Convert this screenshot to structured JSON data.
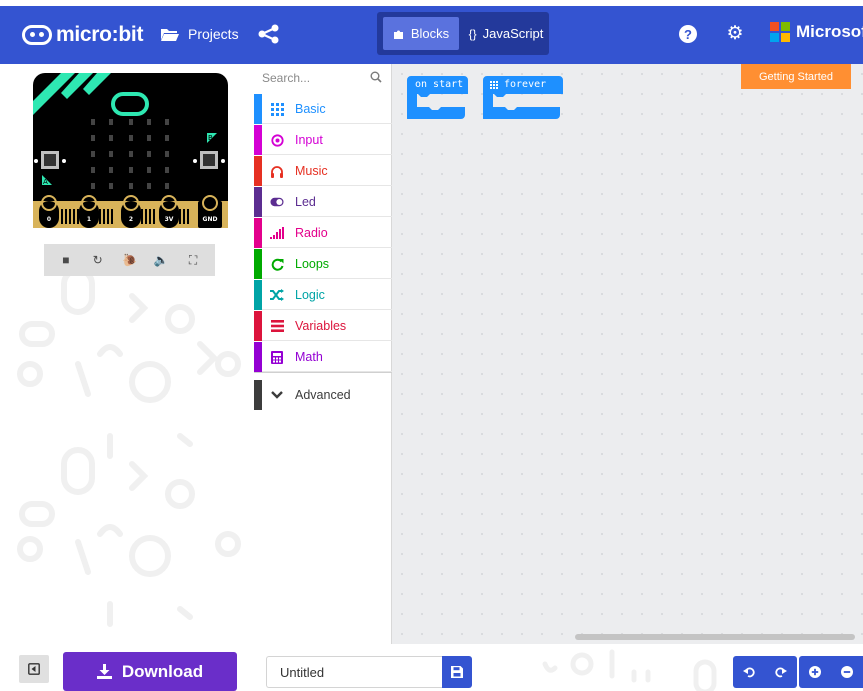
{
  "colors": {
    "header": "#3454d1",
    "header_toggle": "#23399b",
    "blocks_active": "#5a72de",
    "download": "#6a2ec9",
    "getting_started": "#ff8f32",
    "basic": "#1e90ff",
    "input": "#d400d4",
    "music": "#e63022",
    "led": "#5c2d91",
    "radio": "#e3008c",
    "loops": "#00aa00",
    "logic": "#00a4a6",
    "variables": "#dc143c",
    "math": "#9400d3",
    "advanced": "#3c3c3c"
  },
  "header": {
    "logo_text": "micro:bit",
    "logo_icon": "microbit-face-icon",
    "projects_label": "Projects",
    "projects_icon": "folder-open-icon",
    "share_icon": "share-icon",
    "blocks_label": "Blocks",
    "blocks_icon": "puzzle-piece-icon",
    "javascript_label": "JavaScript",
    "javascript_icon": "{}",
    "help_icon": "question-circle-icon",
    "settings_icon": "gear-icon",
    "brand_text": "Microsoft"
  },
  "simulator": {
    "pins": [
      "0",
      "1",
      "2",
      "3V",
      "GND"
    ],
    "button_a": "A",
    "button_b": "B",
    "toolbar": [
      {
        "name": "stop-button",
        "icon": "stop-icon",
        "glyph": "■"
      },
      {
        "name": "restart-button",
        "icon": "refresh-icon",
        "glyph": "↻"
      },
      {
        "name": "slow-mo-button",
        "icon": "snail-icon",
        "glyph": "🐌"
      },
      {
        "name": "mute-button",
        "icon": "volume-icon",
        "glyph": "🔈"
      },
      {
        "name": "fullscreen-button",
        "icon": "expand-icon",
        "glyph": "⛶"
      }
    ]
  },
  "toolbox": {
    "search_placeholder": "Search...",
    "categories": [
      {
        "label": "Basic",
        "icon": "grid-icon",
        "glyph": "▦",
        "color": "#1e90ff"
      },
      {
        "label": "Input",
        "icon": "target-icon",
        "glyph": "◉",
        "color": "#d400d4"
      },
      {
        "label": "Music",
        "icon": "headphones-icon",
        "glyph": "♫",
        "color": "#e63022"
      },
      {
        "label": "Led",
        "icon": "toggle-icon",
        "glyph": "◐",
        "color": "#5c2d91"
      },
      {
        "label": "Radio",
        "icon": "signal-bars-icon",
        "glyph": "▂▄▆",
        "color": "#e3008c"
      },
      {
        "label": "Loops",
        "icon": "loop-icon",
        "glyph": "↻",
        "color": "#00aa00"
      },
      {
        "label": "Logic",
        "icon": "shuffle-icon",
        "glyph": "⤨",
        "color": "#00a4a6"
      },
      {
        "label": "Variables",
        "icon": "list-icon",
        "glyph": "≡",
        "color": "#dc143c"
      },
      {
        "label": "Math",
        "icon": "calculator-icon",
        "glyph": "▦",
        "color": "#9400d3"
      }
    ],
    "advanced": {
      "label": "Advanced",
      "icon": "chevron-down-icon",
      "glyph": "⌄",
      "color": "#3c3c3c"
    }
  },
  "workspace": {
    "getting_started_label": "Getting Started",
    "blocks": [
      {
        "label": "on start",
        "color": "#1e90ff"
      },
      {
        "label": "forever",
        "color": "#1e90ff",
        "icon": "grid-icon"
      }
    ]
  },
  "footer": {
    "download_label": "Download",
    "download_icon": "download-icon",
    "collapse_icon": "collapse-panel-icon",
    "project_name": "Untitled",
    "save_icon": "floppy-disk-icon",
    "undo_icon": "undo-icon",
    "redo_icon": "redo-icon",
    "zoom_in_icon": "zoom-in-icon",
    "zoom_out_icon": "zoom-out-icon"
  }
}
